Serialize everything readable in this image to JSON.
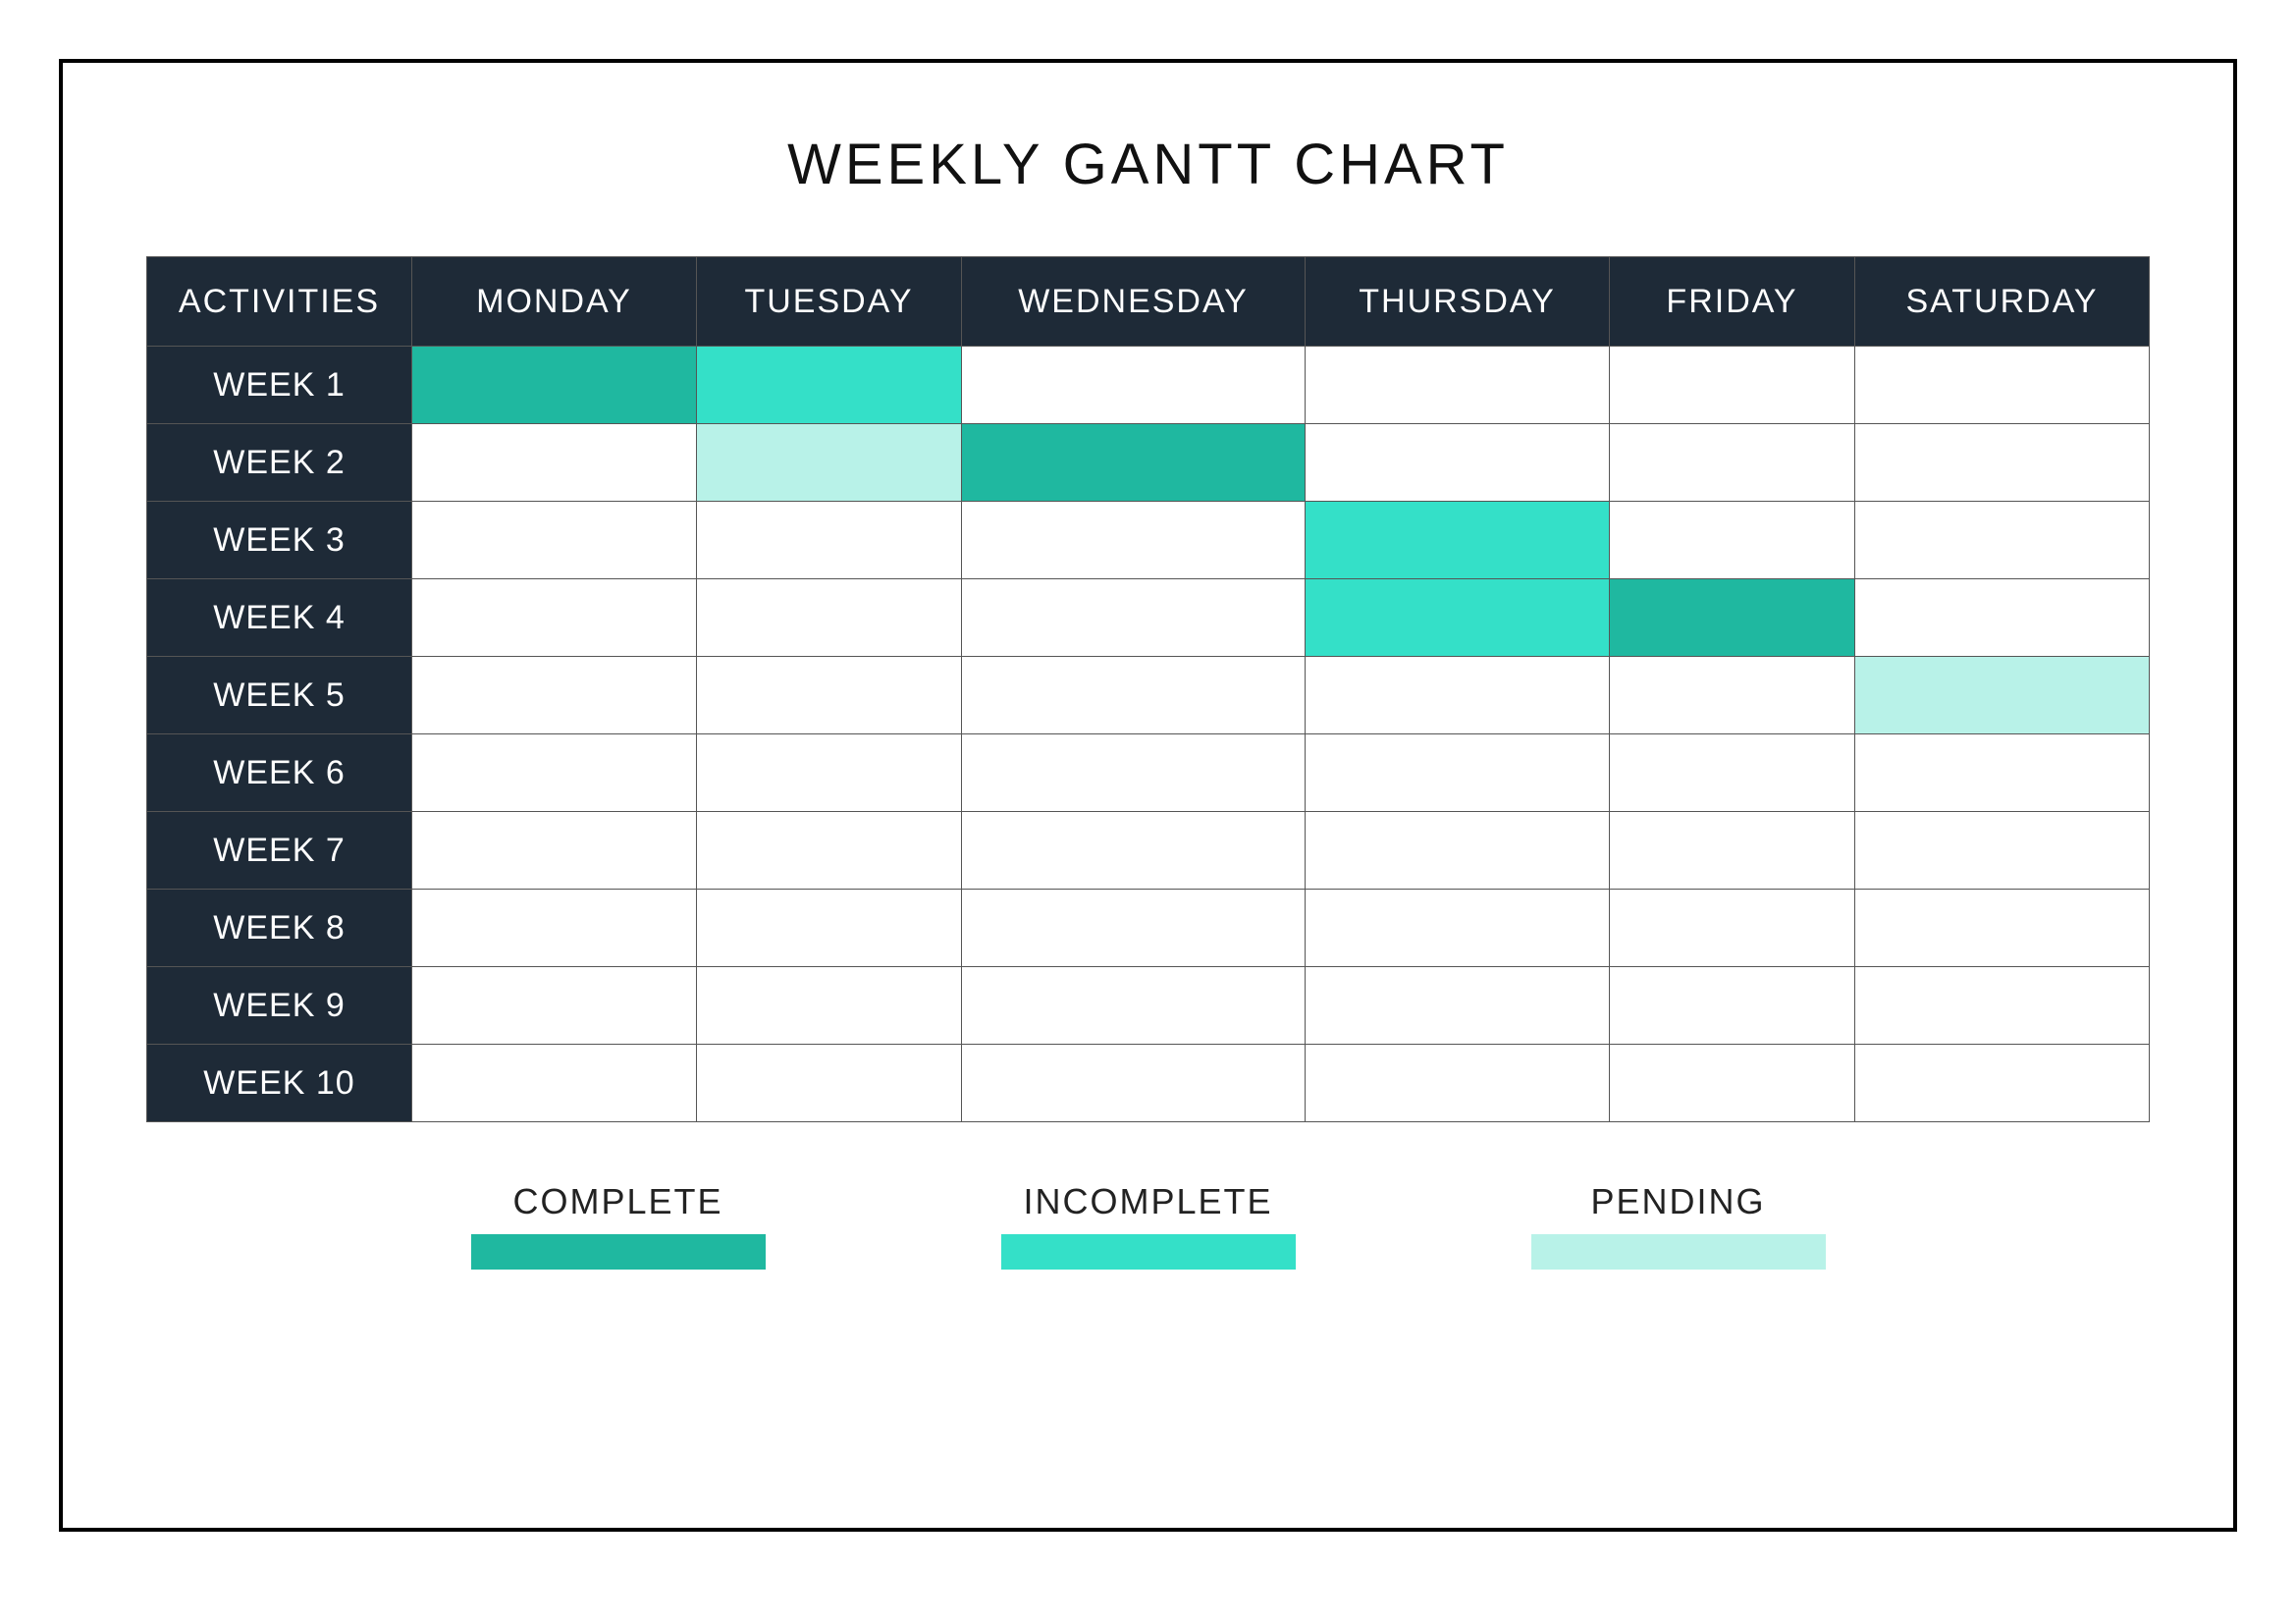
{
  "title": "WEEKLY GANTT CHART",
  "header": {
    "activities": "ACTIVITIES",
    "days": [
      "MONDAY",
      "TUESDAY",
      "WEDNESDAY",
      "THURSDAY",
      "FRIDAY",
      "SATURDAY"
    ]
  },
  "rows": [
    "WEEK 1",
    "WEEK 2",
    "WEEK 3",
    "WEEK 4",
    "WEEK 5",
    "WEEK 6",
    "WEEK 7",
    "WEEK 8",
    "WEEK 9",
    "WEEK 10"
  ],
  "legend": [
    {
      "key": "complete",
      "label": "COMPLETE",
      "color": "#1fb8a0"
    },
    {
      "key": "incomplete",
      "label": "INCOMPLETE",
      "color": "#34e0c8"
    },
    {
      "key": "pending",
      "label": "PENDING",
      "color": "#b8f2e8"
    }
  ],
  "chart_data": {
    "type": "table",
    "title": "WEEKLY GANTT CHART",
    "row_labels": [
      "WEEK 1",
      "WEEK 2",
      "WEEK 3",
      "WEEK 4",
      "WEEK 5",
      "WEEK 6",
      "WEEK 7",
      "WEEK 8",
      "WEEK 9",
      "WEEK 10"
    ],
    "col_labels": [
      "MONDAY",
      "TUESDAY",
      "WEDNESDAY",
      "THURSDAY",
      "FRIDAY",
      "SATURDAY"
    ],
    "status_codes": {
      "": "empty",
      "complete": "COMPLETE",
      "incomplete": "INCOMPLETE",
      "pending": "PENDING"
    },
    "cells": [
      [
        "complete",
        "incomplete",
        "",
        "",
        "",
        ""
      ],
      [
        "",
        "pending",
        "complete",
        "",
        "",
        ""
      ],
      [
        "",
        "",
        "",
        "incomplete",
        "",
        ""
      ],
      [
        "",
        "",
        "",
        "incomplete",
        "complete",
        ""
      ],
      [
        "",
        "",
        "",
        "",
        "",
        "pending"
      ],
      [
        "",
        "",
        "",
        "",
        "",
        ""
      ],
      [
        "",
        "",
        "",
        "",
        "",
        ""
      ],
      [
        "",
        "",
        "",
        "",
        "",
        ""
      ],
      [
        "",
        "",
        "",
        "",
        "",
        ""
      ],
      [
        "",
        "",
        "",
        "",
        "",
        ""
      ]
    ]
  }
}
